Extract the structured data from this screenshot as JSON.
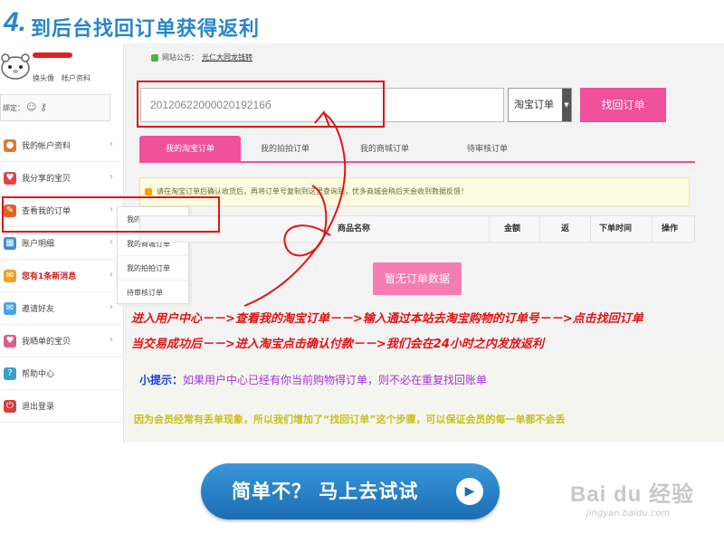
{
  "heading": {
    "number": "4.",
    "text": "到后台找回订单获得返利"
  },
  "sidebar": {
    "user_links": [
      "换头像",
      "帐户资料"
    ],
    "bind_label": "绑定：",
    "menu": [
      {
        "label": "我的帐户资料",
        "icon": "user-icon"
      },
      {
        "label": "我分享的宝贝",
        "icon": "heart-icon"
      },
      {
        "label": "查看我的订单",
        "icon": "order-icon"
      },
      {
        "label": "账户明细",
        "icon": "account-icon"
      },
      {
        "label": "您有1条新消息",
        "icon": "message-icon"
      },
      {
        "label": "邀请好友",
        "icon": "invite-icon"
      },
      {
        "label": "我晒单的宝贝",
        "icon": "share-icon"
      },
      {
        "label": "帮助中心",
        "icon": "help-icon"
      },
      {
        "label": "退出登录",
        "icon": "logout-icon"
      }
    ],
    "submenu": [
      "我的淘宝订单",
      "我的商城订单",
      "我的拍拍订单",
      "待审核订单"
    ]
  },
  "content": {
    "notice_label": "网站公告：",
    "notice_link": "光仁大同龙钱转",
    "order_input_value": "2012062200002019216б",
    "select_value": "淘宝订单",
    "find_button": "找回订单",
    "tabs": [
      "我的淘宝订单",
      "我的拍拍订单",
      "我的商城订单",
      "待审核订单"
    ],
    "tip": "请在淘宝订单后确认收货后，再将订单号复制到这里查询到，优多商城会稍后天会收到数据反馈！",
    "table_headers": [
      "商品名称",
      "金额",
      "返",
      "下单时间",
      "操作"
    ],
    "empty_text": "暂无订单数据"
  },
  "instructions": [
    "进入用户中心－－>查看我的淘宝订单－－>输入通过本站去淘宝购物的订单号－－>点击找回订单",
    "当交易成功后－－>进入淘宝点击确认付款－－>我们会在24小时之内发放返利"
  ],
  "hint": {
    "title": "小提示：",
    "text": "如果用户中心已经有你当前购物得订单，则不必在重复找回账单"
  },
  "warning": "因为会员经常有丢单现象，所以我们增加了“找回订单”这个步骤，可以保证会员的每一单都不会丢",
  "cta": {
    "label": "简单不？ 马上去试试"
  },
  "watermark": {
    "main": "Bai du 经验",
    "sub": "jingyan.baidu.com"
  },
  "colors": {
    "accent": "#2a86c8",
    "pink": "#f0509a",
    "highlight": "#e01515"
  }
}
